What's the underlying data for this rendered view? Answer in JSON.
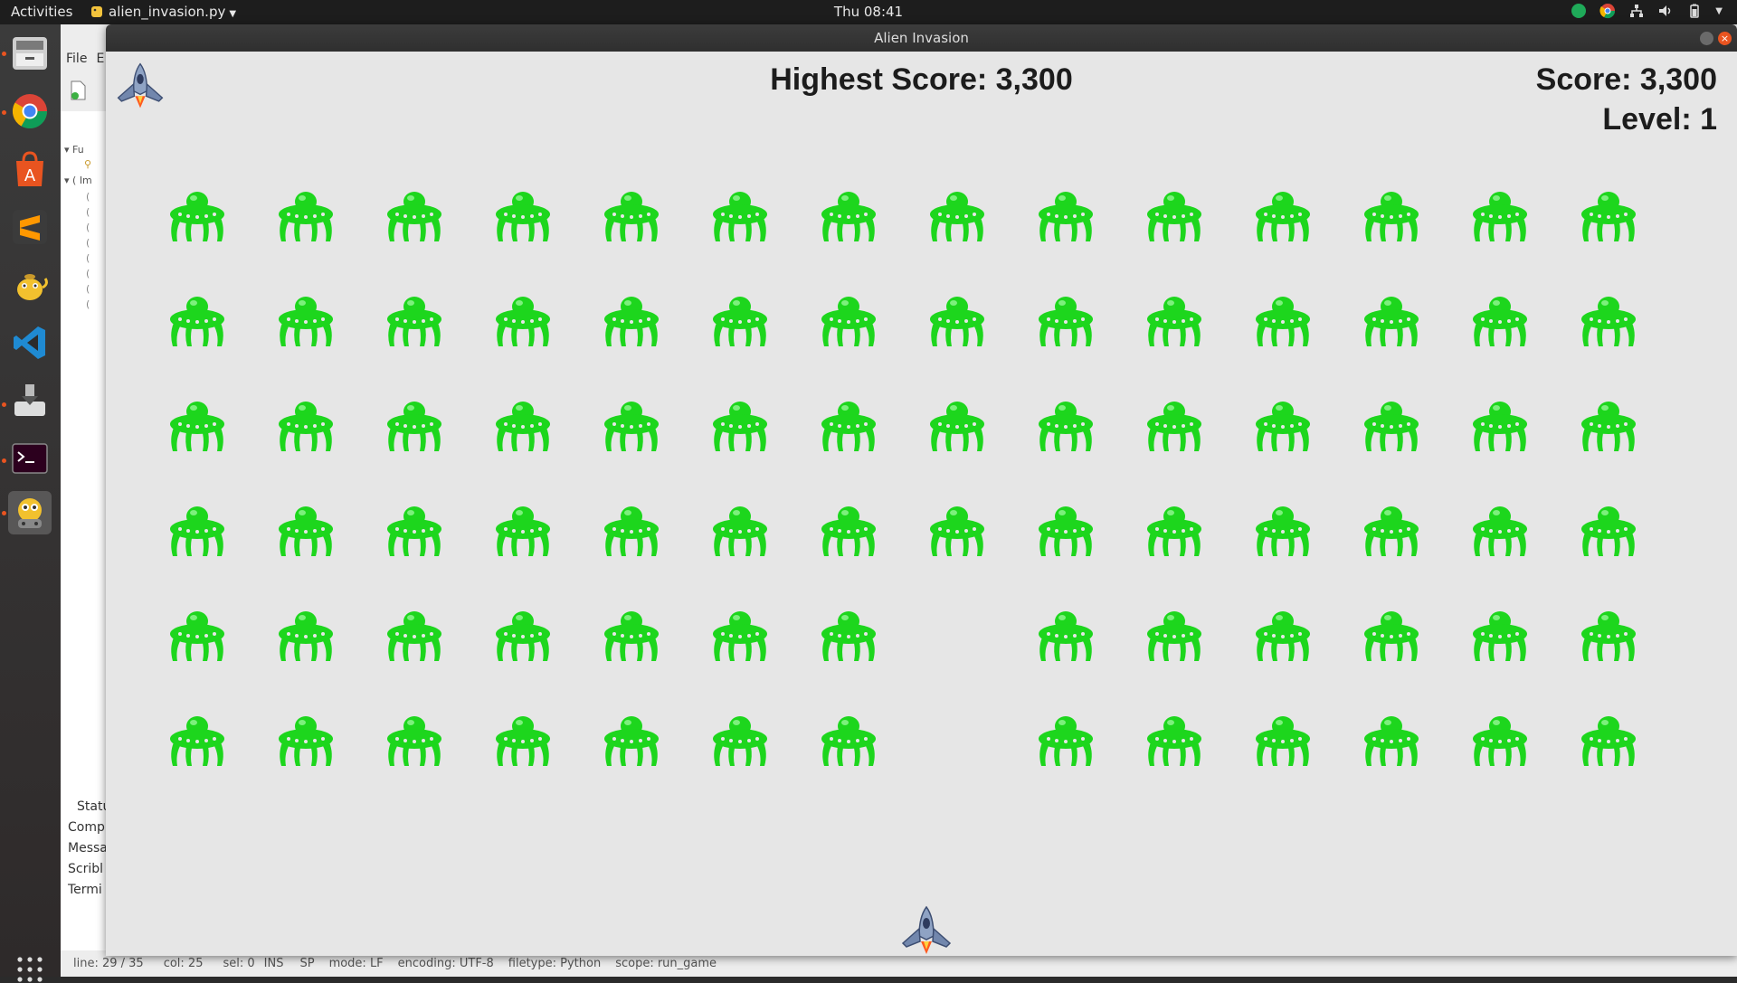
{
  "topbar": {
    "activities": "Activities",
    "app_name": "alien_invasion.py",
    "clock": "Thu 08:41"
  },
  "dock": {
    "items": [
      "files-icon",
      "chrome-icon",
      "software-center-icon",
      "sublime-text-icon",
      "teapot-icon",
      "vscode-icon",
      "installer-icon",
      "terminal-icon",
      "python-game-icon"
    ]
  },
  "editor": {
    "menu": [
      "File",
      "E"
    ],
    "tree": [
      "Fu",
      "Im"
    ],
    "panel_tabs": [
      "Statu",
      "Comp",
      "Messa",
      "Scribl",
      "Termi"
    ],
    "status": {
      "line": "line: 29 / 35",
      "col": "col: 25",
      "sel": "sel: 0",
      "ins": "INS",
      "sp": "SP",
      "mode": "mode: LF",
      "encoding": "encoding: UTF-8",
      "filetype": "filetype: Python",
      "scope": "scope: run_game"
    }
  },
  "game": {
    "window_title": "Alien Invasion",
    "high_score": "Highest Score: 3,300",
    "score": "Score: 3,300",
    "level": "Level: 1",
    "lives": 1,
    "alien_color": "#1dd61d",
    "background": "#e6e6e6",
    "aliens_grid": {
      "rows": 6,
      "cols": 14,
      "missing": [
        [
          4,
          7
        ],
        [
          5,
          7
        ]
      ]
    }
  }
}
